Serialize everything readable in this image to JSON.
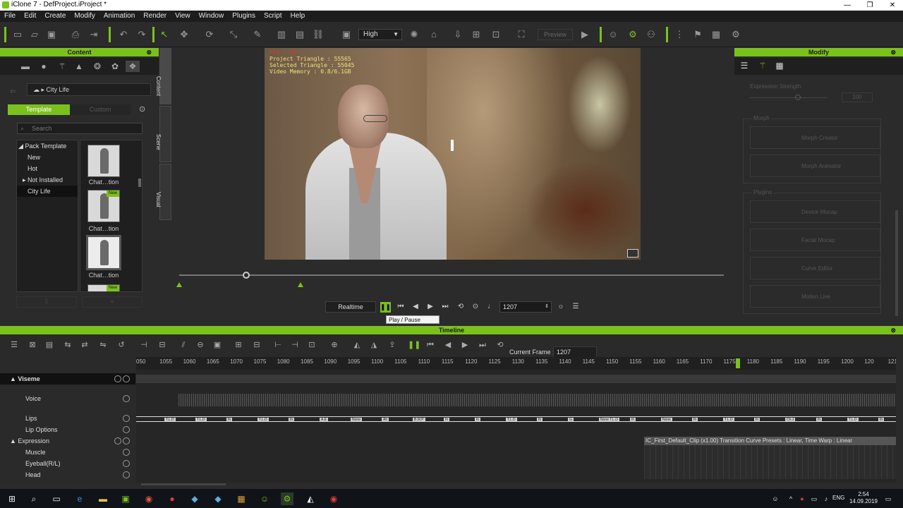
{
  "app": {
    "title": "iClone 7 - DefProject.iProject *"
  },
  "menu": [
    "File",
    "Edit",
    "Create",
    "Modify",
    "Animation",
    "Render",
    "View",
    "Window",
    "Plugins",
    "Script",
    "Help"
  ],
  "toolbar": {
    "quality": "High",
    "preview": "Preview"
  },
  "content": {
    "title": "Content",
    "breadcrumb": "City Life",
    "tab_template": "Template",
    "tab_custom": "Custom",
    "search_placeholder": "Search",
    "tree": [
      {
        "label": "Pack Template"
      },
      {
        "label": "New"
      },
      {
        "label": "Hot"
      },
      {
        "label": "Not Installed"
      },
      {
        "label": "City Life"
      }
    ],
    "thumbs": [
      {
        "label": "Chat…tion"
      },
      {
        "label": "Chat…tion",
        "badge": "New"
      },
      {
        "label": "Chat…tion"
      },
      {
        "label": "",
        "badge": "New"
      }
    ],
    "side_tabs": [
      "Content",
      "Scene",
      "Visual"
    ]
  },
  "viewport": {
    "fps": "FPS : 60",
    "triangles": "Project Triangle : 55565",
    "selected": "Selected Triangle : 55045",
    "memory": "Video Memory : 0.8/6.1GB"
  },
  "playback": {
    "mode": "Realtime",
    "frame": "1207",
    "tooltip": "Play / Pause (Space)"
  },
  "modify": {
    "title": "Modify",
    "expression_strength": "Expression Strength",
    "strength_value": "100",
    "morph_group": "Morph",
    "morph_buttons": [
      "Morph Creator",
      "Morph Animator"
    ],
    "plugins_group": "Plugins",
    "plugin_buttons": [
      "Device Mocap",
      "Facial Mocap",
      "Curve Editor",
      "Motion Live"
    ]
  },
  "timeline": {
    "title": "Timeline",
    "current_frame_label": "Current Frame :",
    "current_frame": "1207",
    "ruler": [
      "050",
      "1055",
      "1060",
      "1065",
      "1070",
      "1075",
      "1080",
      "1085",
      "1090",
      "1095",
      "1100",
      "1105",
      "1110",
      "1115",
      "1120",
      "1125",
      "1130",
      "1135",
      "1140",
      "1145",
      "1150",
      "1155",
      "1160",
      "1165",
      "1170",
      "1175",
      "1180",
      "1185",
      "1190",
      "1195",
      "1200",
      "120",
      "1210"
    ],
    "rows": [
      {
        "label": "Viseme",
        "bold": true,
        "indent": 0
      },
      {
        "label": "Voice",
        "indent": 1
      },
      {
        "label": "Lips",
        "indent": 1
      },
      {
        "label": "Lip Options",
        "indent": 1
      },
      {
        "label": "Expression",
        "indent": 0
      },
      {
        "label": "Muscle",
        "indent": 1
      },
      {
        "label": "Eyeball(R/L)",
        "indent": 1
      },
      {
        "label": "Head",
        "indent": 1
      }
    ],
    "lips": [
      "T.L.D",
      "T.L.D",
      "Ih",
      "T.L.D",
      "Ih",
      "A.E",
      "None",
      "Ah",
      "B.M.P",
      "Ih",
      "Ih",
      "T.L.D",
      "Ih",
      "G",
      "None T.L.D",
      "Ih",
      "None",
      "Ih",
      "T.L.D",
      "Ih",
      "Ch.J",
      "Ih",
      "T.L.D",
      "Ih"
    ],
    "clip": "IC_First_Default_Clip (x1.00) Transition Curve Presets : Linear, Time Warp : Linear"
  },
  "taskbar": {
    "lang": "ENG",
    "time": "2:54",
    "date": "14.09.2019"
  },
  "colors": {
    "accent": "#7bc11c",
    "panel": "#2b2b2b",
    "dark": "#1f1f1f"
  }
}
